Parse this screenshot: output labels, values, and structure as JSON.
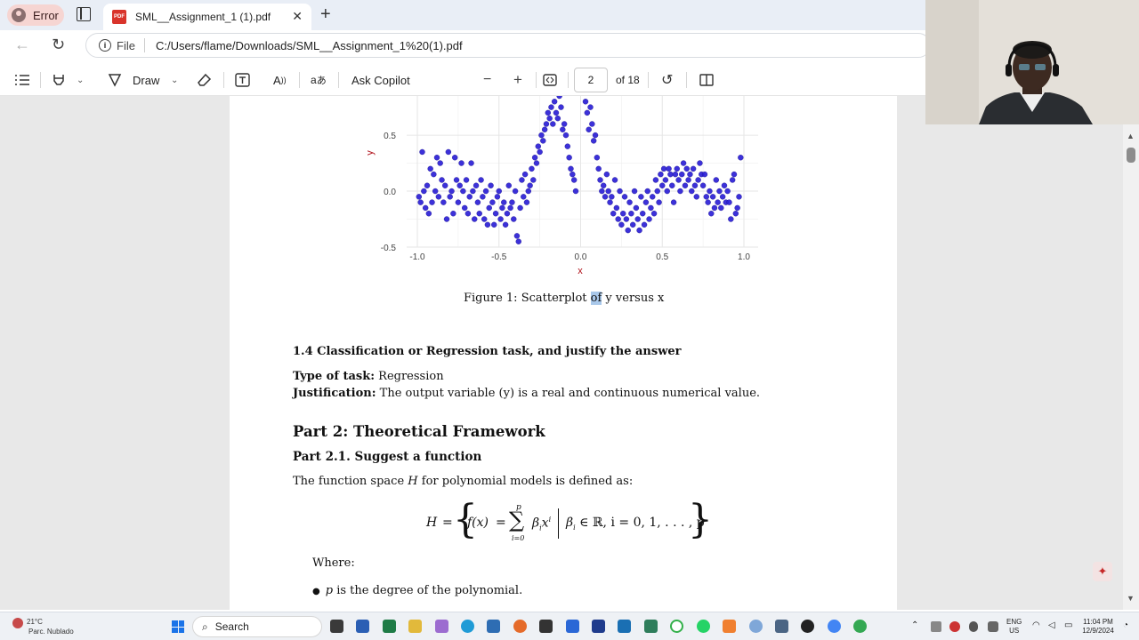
{
  "browser": {
    "profile_label": "Error",
    "tab_title": "SML__Assignment_1 (1).pdf",
    "file_label": "File",
    "url": "C:/Users/flame/Downloads/SML__Assignment_1%20(1).pdf"
  },
  "pdf_toolbar": {
    "draw_label": "Draw",
    "copilot_label": "Ask Copilot",
    "page_number": "2",
    "page_total": "of 18"
  },
  "chart_data": {
    "type": "scatter",
    "xlabel": "x",
    "ylabel": "y",
    "xlim": [
      -1.0,
      1.0
    ],
    "ylim": [
      -0.5,
      0.85
    ],
    "x_ticks": [
      "-1.0",
      "-0.5",
      "0.0",
      "0.5",
      "1.0"
    ],
    "y_ticks": [
      "-0.5",
      "0.0",
      "0.5"
    ],
    "grid": true,
    "point_color": "#2b1fd6",
    "x": [
      -0.99,
      -0.98,
      -0.97,
      -0.96,
      -0.95,
      -0.94,
      -0.93,
      -0.92,
      -0.91,
      -0.9,
      -0.89,
      -0.88,
      -0.87,
      -0.86,
      -0.85,
      -0.84,
      -0.83,
      -0.82,
      -0.81,
      -0.8,
      -0.79,
      -0.78,
      -0.77,
      -0.76,
      -0.75,
      -0.74,
      -0.73,
      -0.72,
      -0.71,
      -0.7,
      -0.69,
      -0.68,
      -0.67,
      -0.66,
      -0.65,
      -0.64,
      -0.63,
      -0.62,
      -0.61,
      -0.6,
      -0.59,
      -0.58,
      -0.57,
      -0.56,
      -0.55,
      -0.54,
      -0.53,
      -0.52,
      -0.51,
      -0.5,
      -0.49,
      -0.48,
      -0.47,
      -0.46,
      -0.45,
      -0.44,
      -0.43,
      -0.42,
      -0.41,
      -0.4,
      -0.39,
      -0.38,
      -0.37,
      -0.36,
      -0.35,
      -0.34,
      -0.33,
      -0.32,
      -0.31,
      -0.3,
      -0.29,
      -0.28,
      -0.27,
      -0.26,
      -0.25,
      -0.24,
      -0.23,
      -0.22,
      -0.21,
      -0.2,
      -0.19,
      -0.18,
      -0.17,
      -0.16,
      -0.15,
      -0.14,
      -0.13,
      -0.12,
      -0.11,
      -0.1,
      -0.09,
      -0.08,
      -0.07,
      -0.06,
      -0.05,
      -0.04,
      -0.03,
      0.03,
      0.04,
      0.05,
      0.06,
      0.07,
      0.08,
      0.09,
      0.1,
      0.11,
      0.12,
      0.13,
      0.14,
      0.15,
      0.16,
      0.17,
      0.18,
      0.19,
      0.2,
      0.21,
      0.22,
      0.23,
      0.24,
      0.25,
      0.26,
      0.27,
      0.28,
      0.29,
      0.3,
      0.31,
      0.32,
      0.33,
      0.34,
      0.35,
      0.36,
      0.37,
      0.38,
      0.39,
      0.4,
      0.41,
      0.42,
      0.43,
      0.44,
      0.45,
      0.46,
      0.47,
      0.48,
      0.49,
      0.5,
      0.51,
      0.52,
      0.53,
      0.54,
      0.55,
      0.56,
      0.57,
      0.58,
      0.59,
      0.6,
      0.61,
      0.62,
      0.63,
      0.64,
      0.65,
      0.66,
      0.67,
      0.68,
      0.69,
      0.7,
      0.71,
      0.72,
      0.73,
      0.74,
      0.75,
      0.76,
      0.77,
      0.78,
      0.79,
      0.8,
      0.81,
      0.82,
      0.83,
      0.84,
      0.85,
      0.86,
      0.87,
      0.88,
      0.89,
      0.9,
      0.91,
      0.92,
      0.93,
      0.94,
      0.95,
      0.96,
      0.97,
      0.98,
      0.99,
      1.0,
      0.54,
      0.58,
      0.62,
      -0.62,
      -0.58,
      0.9,
      0.96
    ],
    "y": [
      -0.05,
      -0.1,
      0.35,
      0.0,
      -0.15,
      0.05,
      -0.2,
      0.2,
      -0.1,
      0.15,
      0.0,
      0.3,
      -0.05,
      0.25,
      0.1,
      -0.1,
      0.05,
      -0.25,
      0.35,
      -0.05,
      0.0,
      -0.2,
      0.3,
      0.1,
      -0.1,
      0.05,
      0.25,
      0.0,
      -0.15,
      0.1,
      -0.2,
      -0.05,
      0.25,
      0.0,
      -0.25,
      0.05,
      -0.1,
      -0.2,
      0.1,
      -0.05,
      -0.25,
      0.0,
      -0.3,
      -0.15,
      0.05,
      -0.1,
      -0.3,
      -0.2,
      -0.05,
      0.0,
      -0.25,
      -0.15,
      -0.1,
      -0.3,
      -0.2,
      0.05,
      -0.15,
      -0.1,
      -0.25,
      0.0,
      -0.4,
      -0.45,
      -0.15,
      0.1,
      -0.05,
      0.15,
      -0.1,
      0.0,
      0.05,
      0.2,
      0.1,
      0.3,
      0.25,
      0.4,
      0.35,
      0.5,
      0.45,
      0.55,
      0.6,
      0.7,
      0.65,
      0.75,
      0.6,
      0.8,
      0.7,
      0.65,
      0.85,
      0.75,
      0.55,
      0.6,
      0.5,
      0.4,
      0.3,
      0.2,
      0.15,
      0.1,
      0.0,
      0.8,
      0.7,
      0.55,
      0.75,
      0.6,
      0.45,
      0.5,
      0.3,
      0.2,
      0.1,
      0.0,
      0.05,
      -0.05,
      0.15,
      0.0,
      -0.1,
      -0.05,
      -0.2,
      0.1,
      -0.15,
      -0.25,
      0.0,
      -0.3,
      -0.2,
      -0.05,
      -0.25,
      -0.35,
      -0.1,
      -0.2,
      -0.3,
      0.0,
      -0.15,
      -0.25,
      -0.35,
      -0.05,
      -0.2,
      -0.3,
      -0.1,
      0.0,
      -0.25,
      -0.15,
      -0.05,
      -0.2,
      0.1,
      0.0,
      -0.1,
      0.15,
      0.05,
      0.2,
      0.1,
      0.0,
      0.2,
      0.15,
      0.05,
      -0.1,
      0.15,
      0.2,
      0.1,
      0.0,
      0.15,
      0.25,
      0.05,
      0.2,
      0.1,
      0.15,
      0.0,
      0.2,
      0.05,
      -0.05,
      0.1,
      0.25,
      0.15,
      0.05,
      0.15,
      -0.05,
      -0.1,
      0.0,
      -0.2,
      -0.05,
      -0.15,
      0.1,
      -0.1,
      0.0,
      -0.15,
      -0.05,
      0.05,
      -0.1,
      0.0,
      -0.1,
      -0.25,
      0.1,
      0.15,
      -0.2,
      -0.15,
      -0.05,
      0.3
    ],
    "note": ""
  },
  "doc": {
    "caption_pre": "Figure 1: Scatterplot ",
    "caption_hl": "of",
    "caption_post": " y versus x",
    "section_14": "1.4   Classification or Regression task, and justify the answer",
    "task_label": "Type of task:",
    "task_value": " Regression",
    "just_label": "Justification:",
    "just_value": " The output variable (y) is a real and continuous numerical value.",
    "part2": "Part 2:  Theoretical Framework",
    "part21": "Part 2.1.  Suggest a function",
    "fs_pre": "The function space ",
    "fs_H": "H",
    "fs_post": " for polynomial models is defined as:",
    "eq_H": "H",
    "eq_eq": "=",
    "eq_fx": "f(x)",
    "eq_eq2": "=",
    "eq_sum": "∑",
    "eq_sup": "p",
    "eq_sub": "i=0",
    "eq_term": "β",
    "eq_term_sub": "i",
    "eq_term_x": "x",
    "eq_term_sup": "i",
    "eq_cond_beta": "β",
    "eq_cond_sub": "i",
    "eq_cond_rest": " ∈ ℝ,  i = 0, 1, . . . , p",
    "where": "Where:",
    "bullet_p": "p",
    "bullet_rest": " is the degree of the polynomial."
  },
  "taskbar": {
    "temp": "21°C",
    "weather": "Parc. Nublado",
    "search": "Search",
    "lang_1": "ENG",
    "lang_2": "US",
    "time": "11:04 PM",
    "date": "12/9/2024"
  }
}
